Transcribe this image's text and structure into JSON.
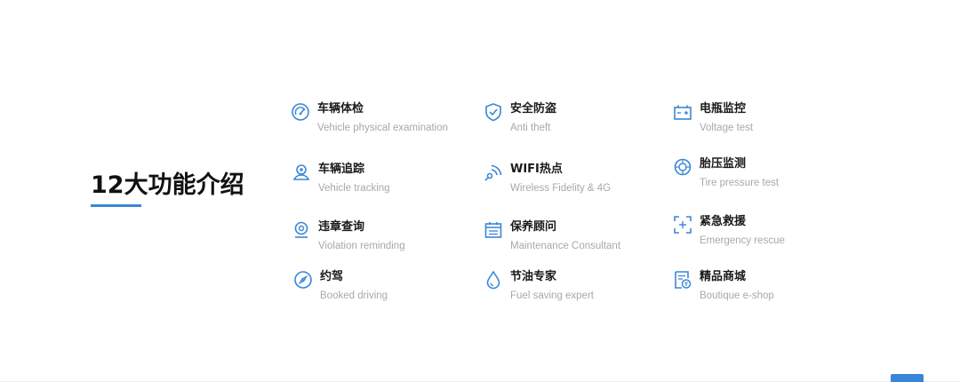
{
  "section": {
    "title": "12大功能介绍"
  },
  "colors": {
    "accent": "#3a86d6",
    "label": "#1a1a1a",
    "desc": "#a8a8a8"
  },
  "features": [
    {
      "icon": "gauge-icon",
      "label": "车辆体检",
      "desc": "Vehicle physical examination"
    },
    {
      "icon": "shield-icon",
      "label": "安全防盗",
      "desc": "Anti theft"
    },
    {
      "icon": "battery-icon",
      "label": "电瓶监控",
      "desc": "Voltage test"
    },
    {
      "icon": "location-person-icon",
      "label": "车辆追踪",
      "desc": "Vehicle tracking"
    },
    {
      "icon": "wifi-icon",
      "label": "WIFI热点",
      "desc": "Wireless Fidelity & 4G"
    },
    {
      "icon": "tire-icon",
      "label": "胎压监测",
      "desc": "Tire pressure test"
    },
    {
      "icon": "violation-pin-icon",
      "label": "违章查询",
      "desc": "Violation reminding"
    },
    {
      "icon": "calendar-icon",
      "label": "保养顾问",
      "desc": "Maintenance Consultant"
    },
    {
      "icon": "emergency-scan-icon",
      "label": "紧急救援",
      "desc": "Emergency rescue"
    },
    {
      "icon": "compass-icon",
      "label": "约驾",
      "desc": "Booked driving"
    },
    {
      "icon": "fuel-drop-icon",
      "label": "节油专家",
      "desc": "Fuel saving expert"
    },
    {
      "icon": "shop-doc-icon",
      "label": "精品商城",
      "desc": "Boutique e-shop"
    }
  ]
}
